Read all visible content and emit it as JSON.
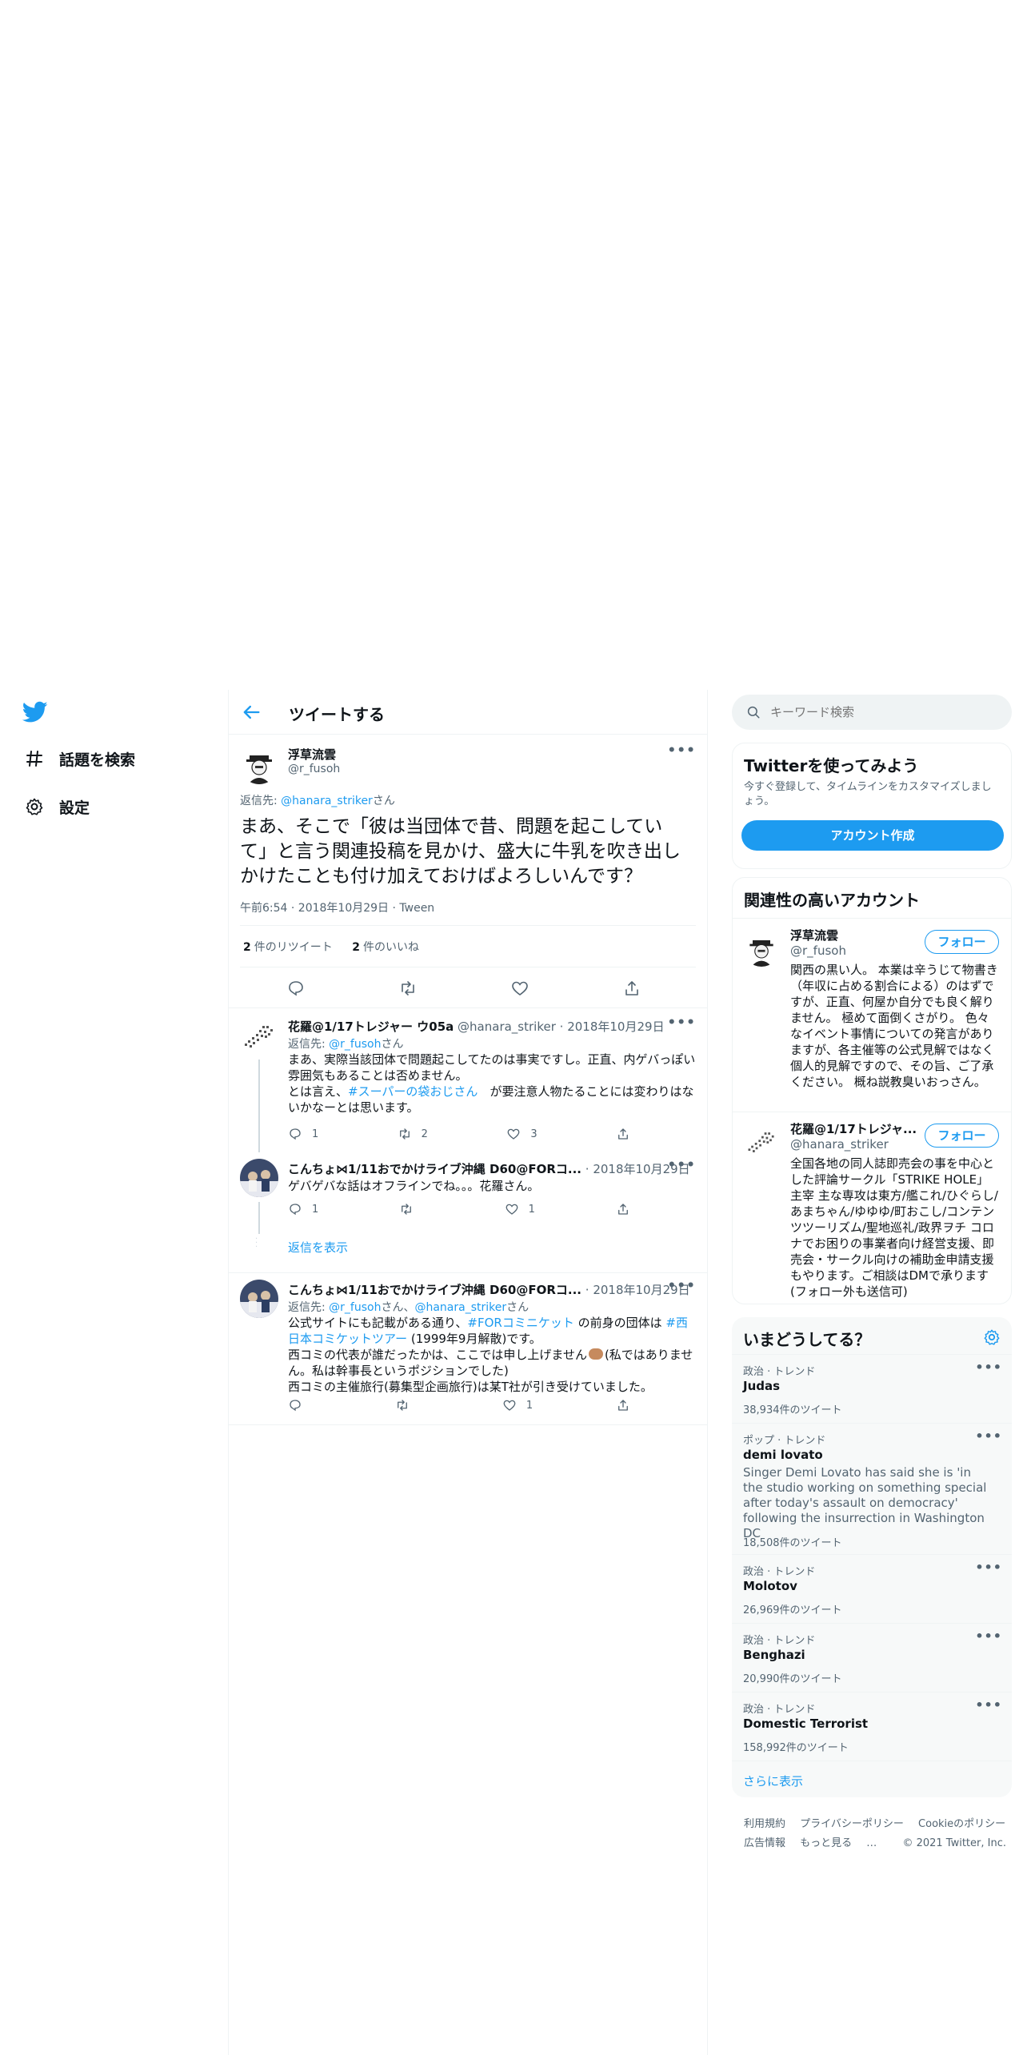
{
  "nav": {
    "explore_label": "話題を検索",
    "settings_label": "設定"
  },
  "header": {
    "title": "ツイートする"
  },
  "main_tweet": {
    "name": "浮草流雲",
    "handle": "@r_fusoh",
    "reply_prefix": "返信先: ",
    "reply_to": "@hanara_striker",
    "reply_suffix": "さん",
    "text": "まあ、そこで「彼は当団体で昔、問題を起こしていて」と言う関連投稿を見かけ、盛大に牛乳を吹き出しかけたことも付け加えておけばよろしいんです？",
    "time": "午前6:54 · 2018年10月29日 · Tween",
    "retweets": "2",
    "retweets_label": "件のリツイート",
    "likes": "2",
    "likes_label": "件のいいね"
  },
  "replies": [
    {
      "name": "花羅@1/17トレジャー ウ05a",
      "handle": "@hanara_striker",
      "date": "2018年10月29日",
      "reply_prefix": "返信先: ",
      "reply_to": "@r_fusoh",
      "reply_suffix": "さん",
      "line1": "まあ、実際当該団体で問題起こしてたのは事実ですし。正直、内ゲバっぽい雰囲気もあることは否めません。",
      "line2_a": "とは言え、",
      "line2_tag": "#スーパーの袋おじさん",
      "line2_b": "　が要注意人物たることには変わりはないかなーとは思います。",
      "reply_count": "1",
      "retweet_count": "2",
      "like_count": "3"
    },
    {
      "name": "こんちょ⋈1/11おでかけライブ沖縄 D60@FORコ...",
      "date": "2018年10月29日",
      "text": "ゲバゲバな話はオフラインでね。。。花羅さん。",
      "reply_count": "1",
      "retweet_count": "",
      "like_count": "1"
    },
    {
      "name": "こんちょ⋈1/11おでかけライブ沖縄 D60@FORコ...",
      "date": "2018年10月29日",
      "reply_prefix": "返信先: ",
      "reply_to_1": "@r_fusoh",
      "reply_mid": "さん、",
      "reply_to_2": "@hanara_striker",
      "reply_suffix": "さん",
      "line1_a": "公式サイトにも記載がある通り、",
      "line1_tag1": "#FORコミニケット",
      "line1_b": " の前身の団体は ",
      "line1_tag2": "#西日本コミケットツアー",
      "line1_c": " (1999年9月解散)です。",
      "line2": "西コミの代表が誰だったかは、ここでは申し上げません",
      "line2_after": "(私ではありません。私は幹事長というポジションでした)",
      "line3": "西コミの主催旅行(募集型企画旅行)は某T社が引き受けていました。",
      "reply_count": "",
      "retweet_count": "",
      "like_count": "1"
    }
  ],
  "show_replies_label": "返信を表示",
  "search": {
    "placeholder": "キーワード検索"
  },
  "signup": {
    "title": "Twitterを使ってみよう",
    "subtitle": "今すぐ登録して、タイムラインをカスタマイズしましょう。",
    "button": "アカウント作成"
  },
  "related": {
    "title": "関連性の高いアカウント",
    "accounts": [
      {
        "name": "浮草流雲",
        "handle": "@r_fusoh",
        "bio": "関西の黒い人。 本業は辛うじて物書き（年収に占める割合による）のはずですが、正直、何屋か自分でも良く解りません。 極めて面倒くさがり。 色々なイベント事情についての発言がありますが、各主催等の公式見解ではなく個人的見解ですので、その旨、ご了承ください。 概ね説教臭いおっさん。",
        "follow": "フォロー"
      },
      {
        "name": "花羅@1/17トレジャ...",
        "handle": "@hanara_striker",
        "bio": "全国各地の同人誌即売会の事を中心とした評論サークル「STRIKE HOLE」主宰 主な専攻は東方/艦これ/ひぐらし/あまちゃん/ゆゆゆ/町おこし/コンテンツツーリズム/聖地巡礼/政界ヲチ コロナでお困りの事業者向け経営支援、即売会・サークル向けの補助金申請支援もやります。ご相談はDMで承ります(フォロー外も送信可)",
        "follow": "フォロー"
      }
    ]
  },
  "trends": {
    "title": "いまどうしてる？",
    "items": [
      {
        "context": "政治 · トレンド",
        "name": "Judas",
        "description": "",
        "count": "38,934件のツイート"
      },
      {
        "context": "ポップ · トレンド",
        "name": "demi lovato",
        "description": "Singer Demi Lovato has said she is 'in the studio working on something special after today's assault on democracy' following the insurrection in Washington DC",
        "count": "18,508件のツイート"
      },
      {
        "context": "政治 · トレンド",
        "name": "Molotov",
        "description": "",
        "count": "26,969件のツイート"
      },
      {
        "context": "政治 · トレンド",
        "name": "Benghazi",
        "description": "",
        "count": "20,990件のツイート"
      },
      {
        "context": "政治 · トレンド",
        "name": "Domestic Terrorist",
        "description": "",
        "count": "158,992件のツイート"
      }
    ],
    "show_more": "さらに表示"
  },
  "footer": {
    "links": [
      "利用規約",
      "プライバシーポリシー",
      "Cookieのポリシー"
    ],
    "links2": [
      "広告情報",
      "もっと見る"
    ],
    "copyright": "© 2021 Twitter, Inc."
  },
  "colors": {
    "accent": "#1d9bf0",
    "text": "#0f1419",
    "secondary": "#536471"
  }
}
